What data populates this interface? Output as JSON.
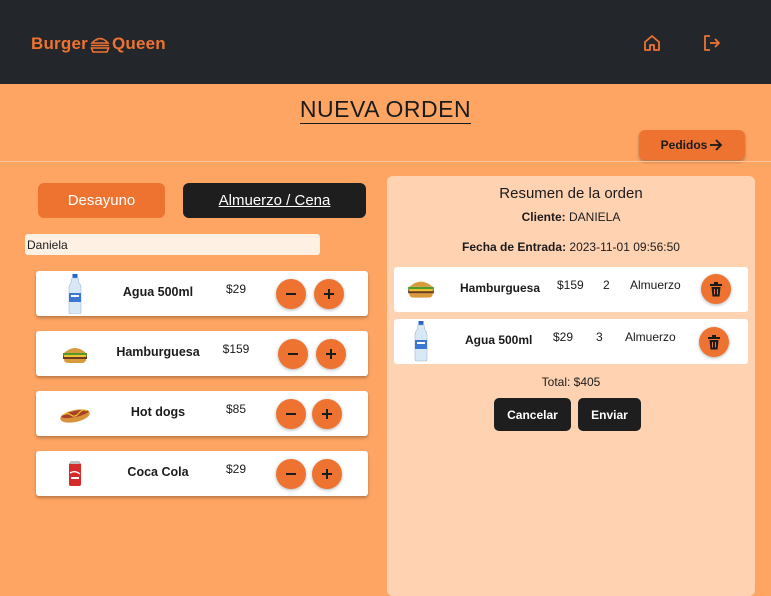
{
  "header": {
    "brand_left": "Burger",
    "brand_right": "Queen",
    "logo_icon": "burger-icon",
    "home_icon": "home-icon",
    "logout_icon": "logout-icon"
  },
  "page": {
    "title": "NUEVA ORDEN",
    "pedidos_label": "Pedidos"
  },
  "menu_tabs": [
    {
      "label": "Desayuno"
    },
    {
      "label": "Almuerzo / Cena"
    }
  ],
  "client_input": {
    "value": "Daniela"
  },
  "products": [
    {
      "name": "Agua 500ml",
      "price": "$29",
      "image": "water-bottle"
    },
    {
      "name": "Hamburguesa",
      "price": "$159",
      "image": "burger"
    },
    {
      "name": "Hot dogs",
      "price": "$85",
      "image": "hot-dog"
    },
    {
      "name": "Coca Cola",
      "price": "$29",
      "image": "soda-can"
    }
  ],
  "summary": {
    "title": "Resumen de la orden",
    "client_label": "Cliente:",
    "client_value": "DANIELA",
    "date_label": "Fecha de Entrada:",
    "date_value": "2023-11-01 09:56:50",
    "items": [
      {
        "name": "Hamburguesa",
        "price": "$159",
        "qty": "2",
        "type": "Almuerzo",
        "image": "burger"
      },
      {
        "name": "Agua 500ml",
        "price": "$29",
        "qty": "3",
        "type": "Almuerzo",
        "image": "water-bottle"
      }
    ],
    "total": "Total: $405",
    "cancel_label": "Cancelar",
    "send_label": "Enviar"
  },
  "colors": {
    "accent": "#ee7330",
    "background": "#ffa563",
    "topbar": "#23262b",
    "panel": "#ffd3b2",
    "dark_button": "#1e1e1e"
  }
}
